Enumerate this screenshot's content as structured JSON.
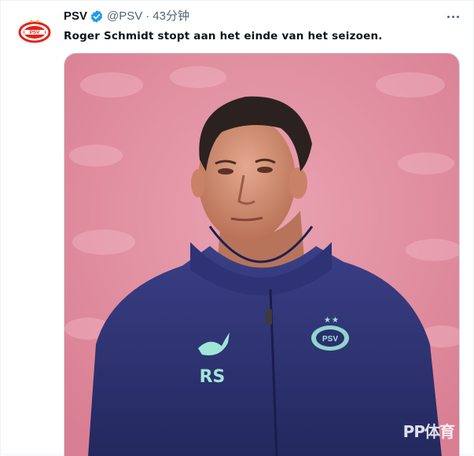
{
  "account": {
    "display_name": "PSV",
    "handle": "@PSV",
    "separator": "·",
    "time": "43分钟",
    "avatar_icon": "psv-logo-icon",
    "verified_icon": "verified-badge-icon",
    "verified_color": "#1d9bf0"
  },
  "tweet": {
    "text": "Roger Schmidt stopt aan het einde van het seizoen."
  },
  "menu": {
    "more_icon": "more-dots-icon"
  },
  "media": {
    "jacket_logo_text": "PSV",
    "jacket_initials": "RS",
    "watermark_text": "PP体育"
  },
  "colors": {
    "stadium_pink": "#e89aa8",
    "jacket_navy": "#2a2f6e",
    "psv_red": "#e2231a",
    "logo_mint": "#9fe6d7"
  }
}
